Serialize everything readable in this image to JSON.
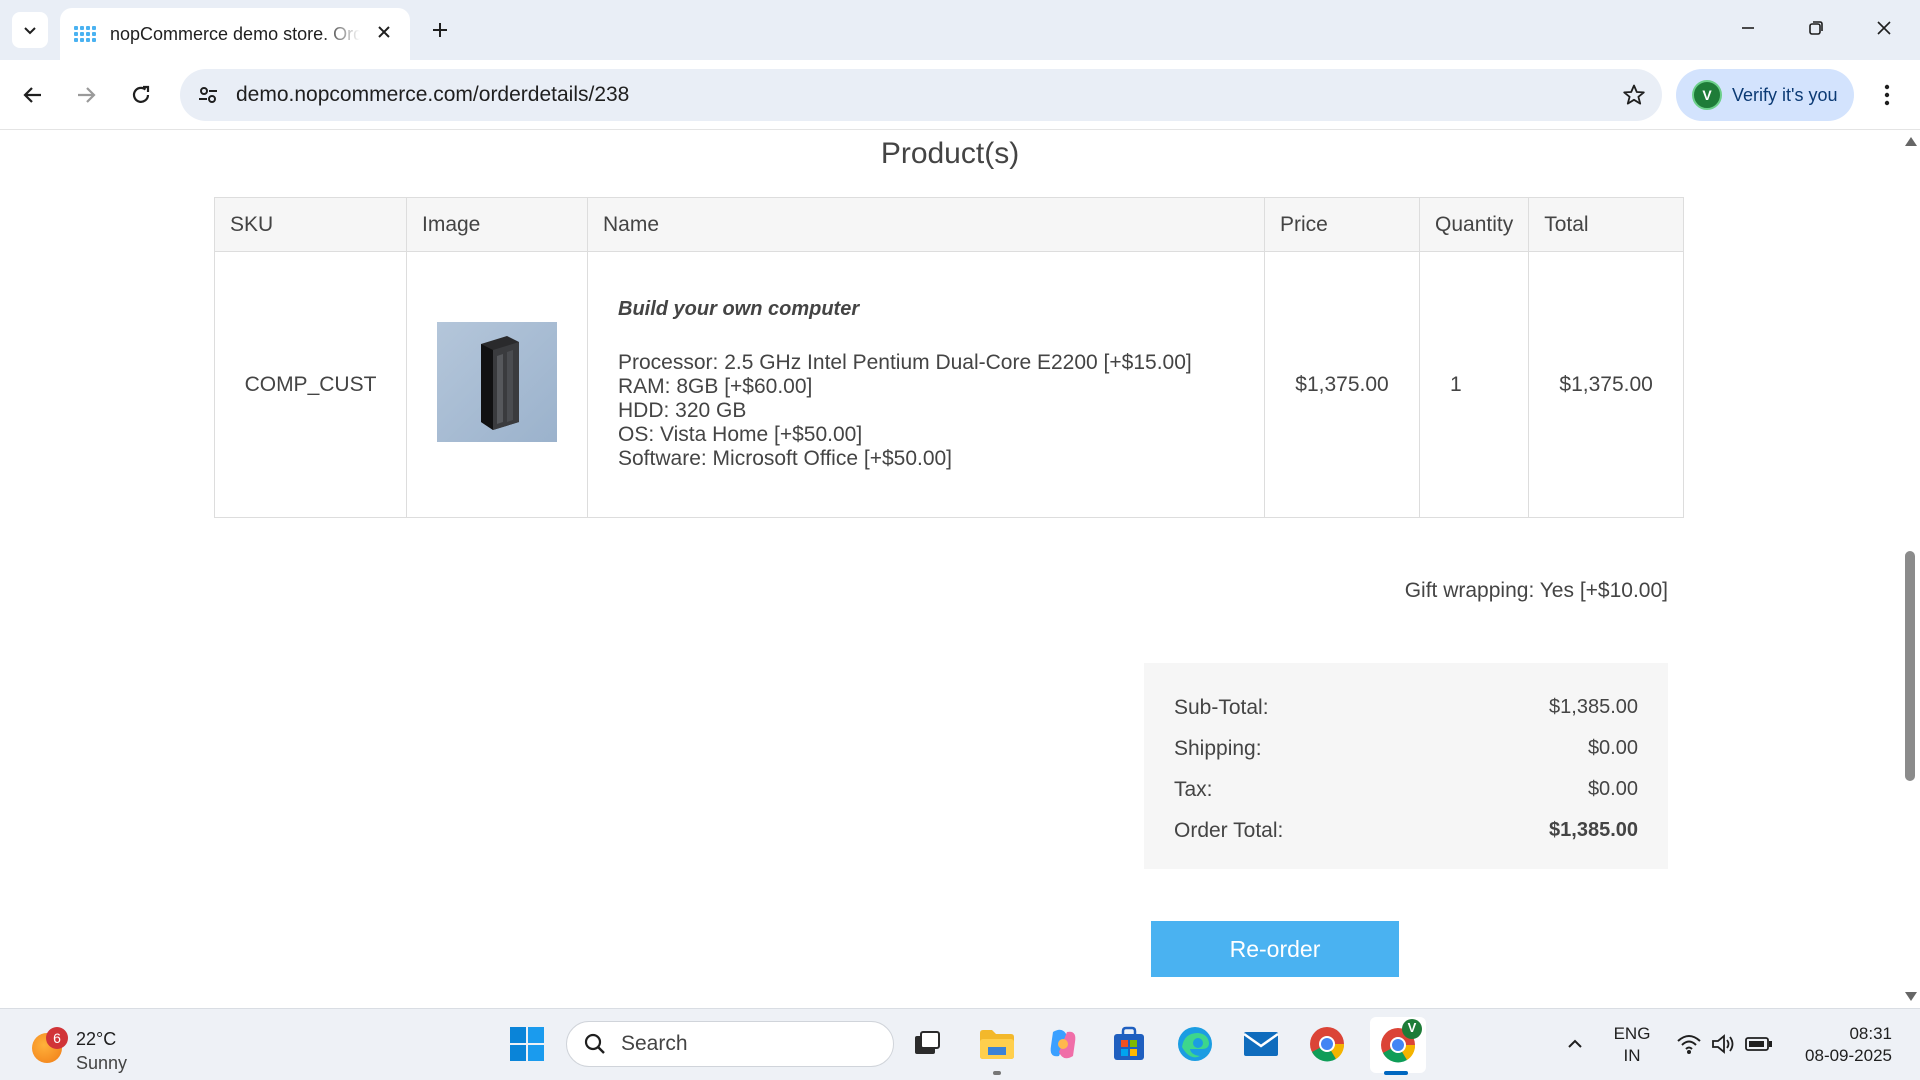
{
  "browser": {
    "tab_title": "nopCommerce demo store. Order",
    "url": "demo.nopcommerce.com/orderdetails/238",
    "verify_label": "Verify it's you",
    "avatar_letter": "V"
  },
  "section": {
    "title": "Product(s)"
  },
  "table": {
    "headers": [
      "SKU",
      "Image",
      "Name",
      "Price",
      "Quantity",
      "Total"
    ],
    "row": {
      "sku": "COMP_CUST",
      "name": "Build your own computer",
      "attributes": [
        "Processor: 2.5 GHz Intel Pentium Dual-Core E2200 [+$15.00]",
        "RAM: 8GB [+$60.00]",
        "HDD: 320 GB",
        "OS: Vista Home [+$50.00]",
        "Software: Microsoft Office [+$50.00]"
      ],
      "price": "$1,375.00",
      "quantity": "1",
      "total": "$1,375.00"
    }
  },
  "gift_wrapping": "Gift wrapping: Yes [+$10.00]",
  "totals": {
    "subtotal_label": "Sub-Total:",
    "subtotal_value": "$1,385.00",
    "shipping_label": "Shipping:",
    "shipping_value": "$0.00",
    "tax_label": "Tax:",
    "tax_value": "$0.00",
    "order_total_label": "Order Total:",
    "order_total_value": "$1,385.00"
  },
  "reorder_label": "Re-order",
  "taskbar": {
    "weather_badge": "6",
    "temperature": "22°C",
    "condition": "Sunny",
    "search_placeholder": "Search",
    "lang_line1": "ENG",
    "lang_line2": "IN",
    "time": "08:31",
    "date": "08-09-2025",
    "chrome_badge": "V"
  },
  "colors": {
    "accent": "#4ab2f1",
    "table_header_bg": "#f6f6f6",
    "totals_bg": "#f6f6f6"
  }
}
